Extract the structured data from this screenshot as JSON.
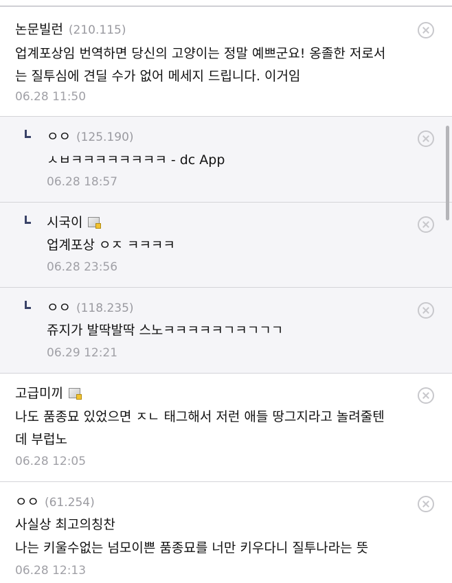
{
  "comments": [
    {
      "author": "논문빌런",
      "ip": "(210.115)",
      "lines": [
        "업계포상임 번역하면 당신의 고양이는 정말 예쁘군요! 옹졸한 저로서",
        "는 질투심에 견딜 수가 없어 메세지 드립니다. 이거임"
      ],
      "date": "06.28 11:50"
    },
    {
      "author": "ㅇㅇ",
      "ip": "(125.190)",
      "lines": [
        "ㅅㅂㅋㅋㅋㅋㅋㅋㅋㅋ - dc App"
      ],
      "date": "06.28 18:57"
    },
    {
      "author": "시국이",
      "lines": [
        "업계포상 ㅇㅈ ㅋㅋㅋㅋ"
      ],
      "date": "06.28 23:56"
    },
    {
      "author": "ㅇㅇ",
      "ip": "(118.235)",
      "lines": [
        "쥬지가 발딱발딱 스노ㅋㅋㅋㅋㅋㄱㅋㄱㄱㄱ"
      ],
      "date": "06.29 12:21"
    },
    {
      "author": "고급미끼",
      "lines": [
        "나도 품종묘 있었으면 ㅈㄴ 태그해서 저런 애들 땅그지라고 놀려줄텐",
        "데 부럽노"
      ],
      "date": "06.28 12:05"
    },
    {
      "author": "ㅇㅇ",
      "ip": "(61.254)",
      "lines": [
        "사실상 최고의칭찬",
        "나는 키울수없는 넘모이쁜 품종묘를 너만 키우다니 질투나라는 뜻"
      ],
      "date": "06.28 12:13"
    }
  ]
}
